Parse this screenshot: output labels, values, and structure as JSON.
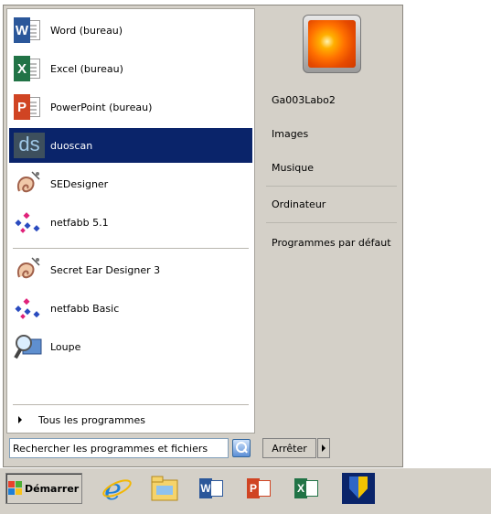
{
  "programs": [
    {
      "label": "Word (bureau)",
      "icon": "word-icon",
      "color": "#2b579a",
      "letter": "W"
    },
    {
      "label": "Excel (bureau)",
      "icon": "excel-icon",
      "color": "#217346",
      "letter": "X"
    },
    {
      "label": "PowerPoint (bureau)",
      "icon": "powerpoint-icon",
      "color": "#d04423",
      "letter": "P"
    },
    {
      "label": "duoscan",
      "icon": "duoscan-icon",
      "selected": true,
      "letter": "ds"
    },
    {
      "label": "SEDesigner",
      "icon": "sedesigner-icon"
    },
    {
      "label": "netfabb 5.1",
      "icon": "netfabb-icon"
    },
    {
      "label": "Secret Ear Designer 3",
      "icon": "secret-ear-designer-icon"
    },
    {
      "label": "netfabb Basic",
      "icon": "netfabb-basic-icon"
    },
    {
      "label": "Loupe",
      "icon": "magnifier-icon"
    }
  ],
  "all_programs": "Tous les programmes",
  "search": {
    "value": "Rechercher les programmes et fichiers"
  },
  "right_items": [
    {
      "label": "Ga003Labo2"
    },
    {
      "label": "Images"
    },
    {
      "label": "Musique"
    },
    {
      "label": "Ordinateur"
    },
    {
      "label": "Programmes par défaut"
    }
  ],
  "shutdown": "Arrêter",
  "taskbar": {
    "start_label": "Démarrer",
    "apps": [
      "internet-explorer-icon",
      "file-explorer-icon",
      "word-icon",
      "powerpoint-icon",
      "excel-icon",
      "security-shield-icon"
    ]
  },
  "colors": {
    "selection": "#0a246a",
    "menu_bg": "#d4d0c8"
  }
}
